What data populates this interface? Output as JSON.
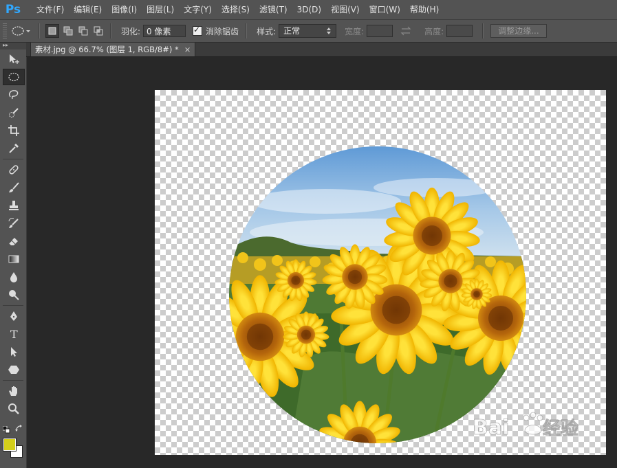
{
  "app": {
    "logo": "Ps",
    "brand_color": "#31a8ff"
  },
  "menubar": {
    "items": [
      "文件(F)",
      "编辑(E)",
      "图像(I)",
      "图层(L)",
      "文字(Y)",
      "选择(S)",
      "滤镜(T)",
      "3D(D)",
      "视图(V)",
      "窗口(W)",
      "帮助(H)"
    ]
  },
  "options": {
    "feather_label": "羽化:",
    "feather_value": "0 像素",
    "antialias_label": "消除锯齿",
    "antialias_checked": true,
    "style_label": "样式:",
    "style_value": "正常",
    "width_label": "宽度:",
    "height_label": "高度:",
    "refine_edge_button": "调整边缘..."
  },
  "document": {
    "tab_title": "素材.jpg @ 66.7% (图层 1, RGB/8#) *",
    "close_glyph": "×"
  },
  "colors": {
    "foreground": "#d4cf1b",
    "background": "#ffffff"
  },
  "toolbar": {
    "tools": [
      "move-tool",
      "elliptical-marquee-tool",
      "lasso-tool",
      "quick-selection-tool",
      "crop-tool",
      "eyedropper-tool",
      "spot-healing-brush-tool",
      "brush-tool",
      "clone-stamp-tool",
      "history-brush-tool",
      "eraser-tool",
      "gradient-tool",
      "blur-tool",
      "dodge-tool",
      "pen-tool",
      "type-tool",
      "path-selection-tool",
      "shape-tool",
      "hand-tool",
      "zoom-tool"
    ],
    "active_tool": "elliptical-marquee-tool"
  },
  "watermark": {
    "text": "Bai du 经验"
  }
}
